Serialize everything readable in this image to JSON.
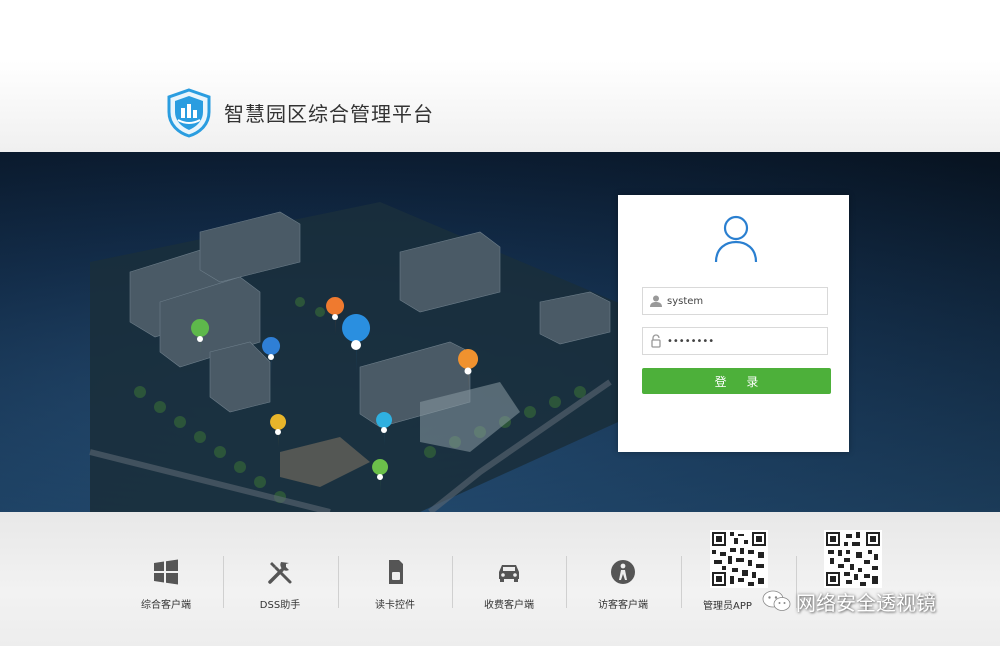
{
  "header": {
    "title": "智慧园区综合管理平台",
    "logo_icon": "shield-building-icon"
  },
  "login": {
    "avatar_icon": "user-avatar-icon",
    "username": {
      "value": "system",
      "icon": "user-icon"
    },
    "password": {
      "value": "••••••••",
      "icon": "lock-icon"
    },
    "submit_label": "登 录",
    "submit_color": "#4db03a"
  },
  "footer": {
    "tools": [
      {
        "label": "综合客户端",
        "icon": "windows-icon"
      },
      {
        "label": "DSS助手",
        "icon": "tools-icon"
      },
      {
        "label": "读卡控件",
        "icon": "sim-card-icon"
      },
      {
        "label": "收费客户端",
        "icon": "car-icon"
      },
      {
        "label": "访客客户端",
        "icon": "visitor-icon"
      }
    ],
    "qr": [
      {
        "label": "管理员APP"
      }
    ]
  },
  "watermark": {
    "text": "网络安全透视镜",
    "icon": "wechat-icon"
  },
  "colors": {
    "accent": "#4db03a",
    "logo_blue": "#2a9de0",
    "hero_dark": "#0f2540"
  }
}
